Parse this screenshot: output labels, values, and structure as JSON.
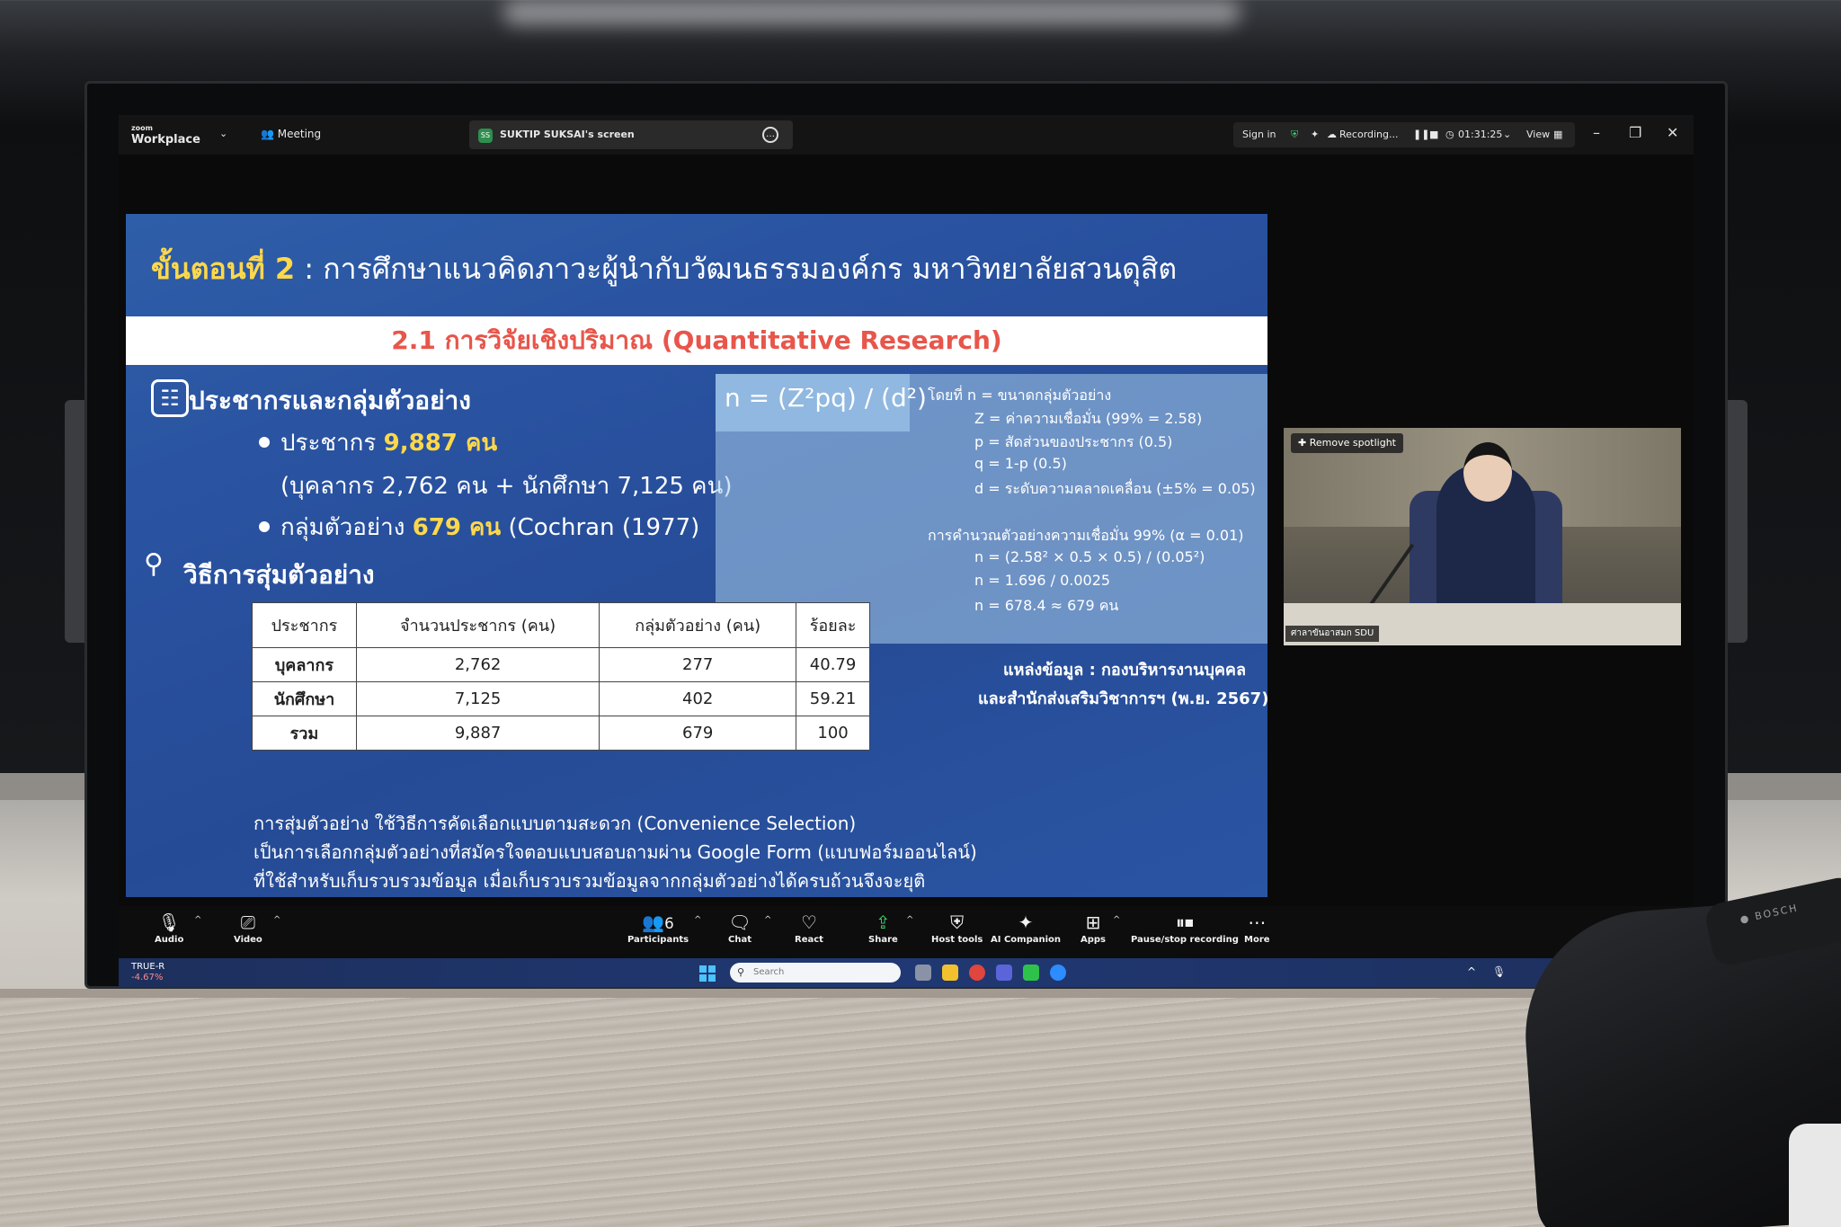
{
  "zoom": {
    "logo_top": "zoom",
    "logo_bottom": "Workplace",
    "meeting_label": "Meeting",
    "share_initials": "SS",
    "share_label": "SUKTIP SUKSAI's screen",
    "sign_in": "Sign in",
    "recording": "Recording...",
    "timer": "01:31:25",
    "view": "View"
  },
  "slide": {
    "title_step": "ขั้นตอนที่ 2",
    "title_rest": " : การศึกษาแนวคิดภาวะผู้นำกับวัฒนธรรมองค์กร มหาวิทยาลัยสวนดุสิต",
    "banner": "2.1 การวิจัยเชิงปริมาณ (Quantitative Research)",
    "section1": "ประชากรและกลุ่มตัวอย่าง",
    "population_label": "ประชากร ",
    "population_value": "9,887 คน",
    "population_detail": "(บุคลากร 2,762 คน + นักศึกษา 7,125 คน)",
    "sample_label": "กลุ่มตัวอย่าง ",
    "sample_value": "679 คน",
    "sample_ref": "  (Cochran (1977)",
    "section2": "วิธีการสุ่มตัวอย่าง",
    "formula": "n = (Z²pq) / (d²)",
    "formula_lines": [
      "โดยที่  n = ขนาดกลุ่มตัวอย่าง",
      "Z = ค่าความเชื่อมั่น (99% = 2.58)",
      "p = สัดส่วนของประชากร (0.5)",
      "q = 1-p (0.5)",
      "d = ระดับความคลาดเคลื่อน (±5% = 0.05)"
    ],
    "calc_lines": [
      "การคำนวณตัวอย่างความเชื่อมั่น 99% (α = 0.01)",
      "n = (2.58² × 0.5 × 0.5) / (0.05²)",
      "n = 1.696 / 0.0025",
      "n = 678.4 ≈ 679 คน"
    ],
    "source_1": "แหล่งข้อมูล : กองบริหารงานบุคคล",
    "source_2": "และสำนักส่งเสริมวิชาการฯ (พ.ย. 2567)",
    "table": {
      "headers": [
        "ประชากร",
        "จำนวนประชากร (คน)",
        "กลุ่มตัวอย่าง (คน)",
        "ร้อยละ"
      ],
      "rows": [
        [
          "บุคลากร",
          "2,762",
          "277",
          "40.79"
        ],
        [
          "นักศึกษา",
          "7,125",
          "402",
          "59.21"
        ],
        [
          "รวม",
          "9,887",
          "679",
          "100"
        ]
      ]
    },
    "notes": [
      "การสุ่มตัวอย่าง ใช้วิธีการคัดเลือกแบบตามสะดวก (Convenience Selection)",
      "เป็นการเลือกกลุ่มตัวอย่างที่สมัครใจตอบแบบสอบถามผ่าน Google Form (แบบฟอร์มออนไลน์)",
      "ที่ใช้สำหรับเก็บรวบรวมข้อมูล เมื่อเก็บรวบรวมข้อมูลจากกลุ่มตัวอย่างได้ครบถ้วนจึงจะยุติ"
    ]
  },
  "video": {
    "spotlight_label": "Remove spotlight",
    "name_tag": "ศาลาขันอาสมก SDU"
  },
  "toolbar": {
    "audio": "Audio",
    "video": "Video",
    "participants_count": "6",
    "participants": "Participants",
    "chat": "Chat",
    "react": "React",
    "share": "Share",
    "host_tools": "Host tools",
    "ai_companion": "AI Companion",
    "apps": "Apps",
    "pause_recording": "Pause/stop recording",
    "more": "More"
  },
  "taskbar": {
    "stock_name": "TRUE-R",
    "stock_change": "-4.67%",
    "search_placeholder": "Search"
  }
}
